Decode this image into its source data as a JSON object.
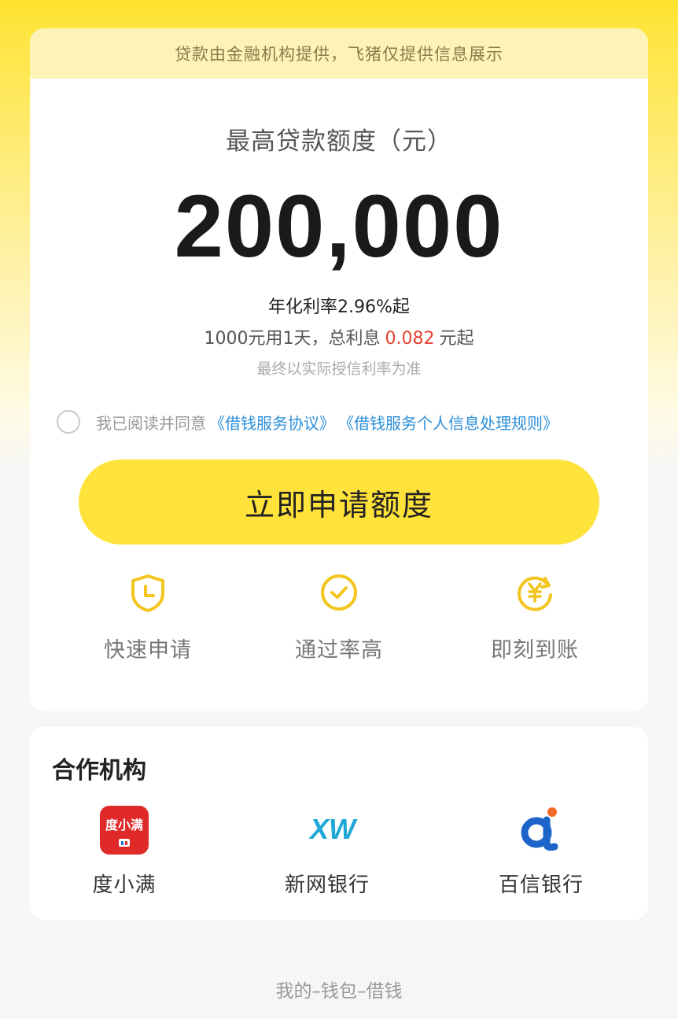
{
  "notice": "贷款由金融机构提供，飞猪仅提供信息展示",
  "loan": {
    "title": "最高贷款额度（元）",
    "amount": "200,000",
    "rate": "年化利率2.96%起",
    "interest_prefix": "1000元用1天，总利息",
    "interest_value": "0.082",
    "interest_suffix": "元起",
    "disclaimer": "最终以实际授信利率为准"
  },
  "agreement": {
    "checked": false,
    "text": "我已阅读并同意",
    "link1": "《借钱服务协议》",
    "link2": "《借钱服务个人信息处理规则》"
  },
  "apply_button": "立即申请额度",
  "features": [
    {
      "label": "快速申请",
      "icon": "shield-clock-icon"
    },
    {
      "label": "通过率高",
      "icon": "check-circle-icon"
    },
    {
      "label": "即刻到账",
      "icon": "yuan-refresh-icon"
    }
  ],
  "partners": {
    "title": "合作机构",
    "items": [
      {
        "name": "度小满",
        "logo_text": "度小满",
        "logo": "duxiaoman-logo"
      },
      {
        "name": "新网银行",
        "logo_text": "XW",
        "logo": "xinwang-logo"
      },
      {
        "name": "百信银行",
        "logo_text": "a",
        "logo": "baixin-logo"
      }
    ]
  },
  "footer": "我的–钱包–借钱",
  "colors": {
    "brand_yellow": "#ffe23a",
    "link_blue": "#2c8fd8",
    "highlight_red": "#e8412f"
  }
}
